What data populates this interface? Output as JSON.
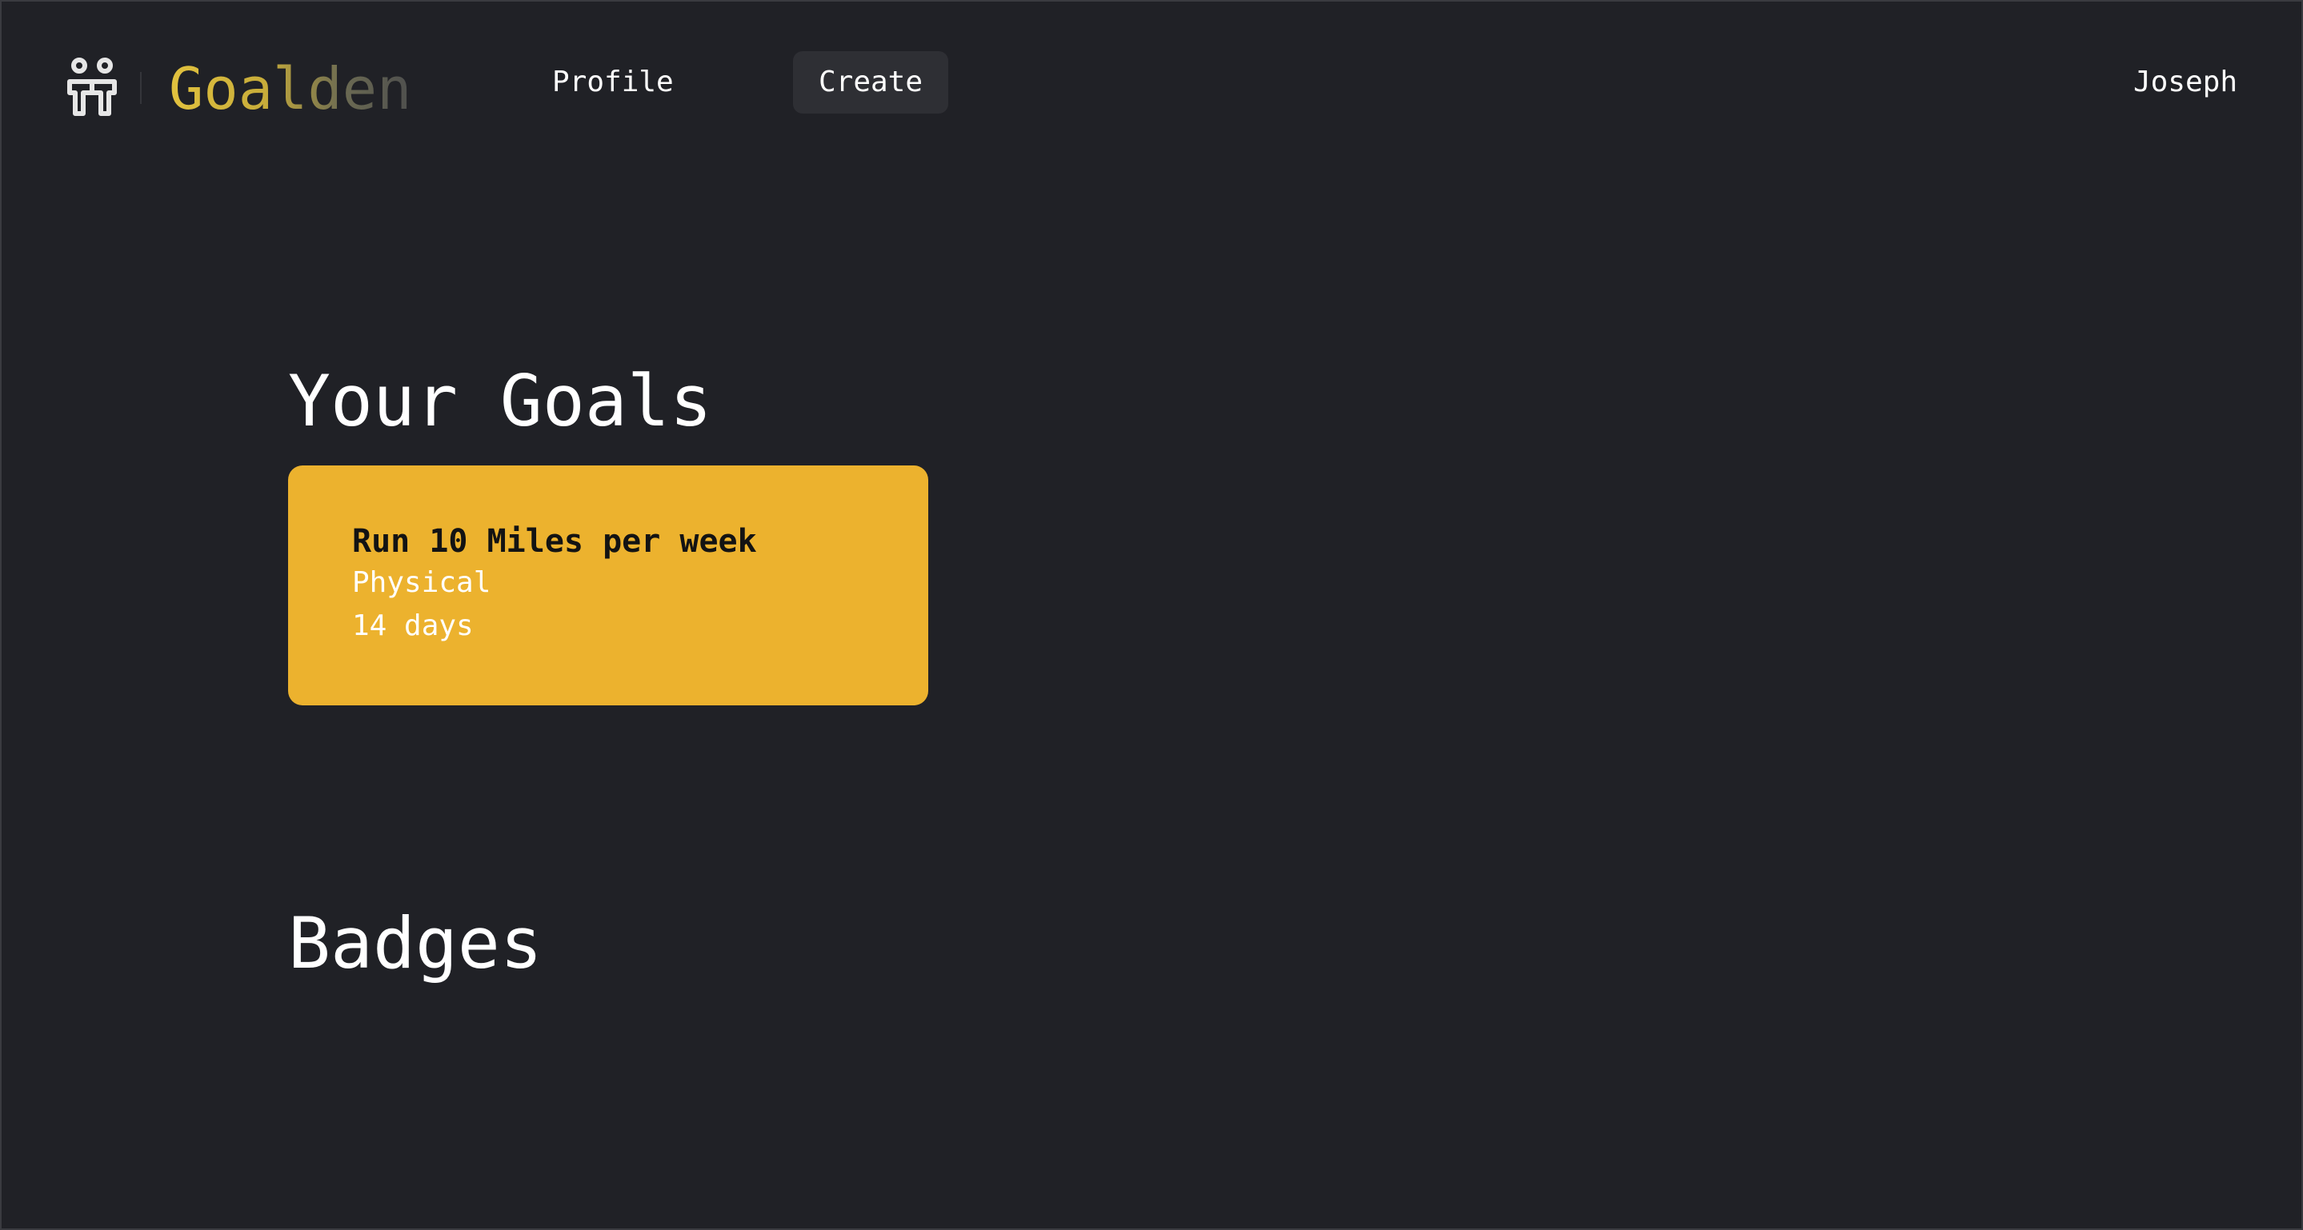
{
  "app": {
    "brand": "Goalden",
    "logo_icon": "two-people-icon",
    "colors": {
      "background": "#202126",
      "accent": "#ecb22e",
      "nav_active_bg": "#2e2f34"
    }
  },
  "nav": {
    "profile_label": "Profile",
    "create_label": "Create",
    "user_label": "Joseph"
  },
  "main": {
    "goals_heading": "Your Goals",
    "goals": [
      {
        "title": "Run 10 Miles per week",
        "category": "Physical",
        "duration": "14 days"
      }
    ],
    "badges_heading": "Badges"
  }
}
